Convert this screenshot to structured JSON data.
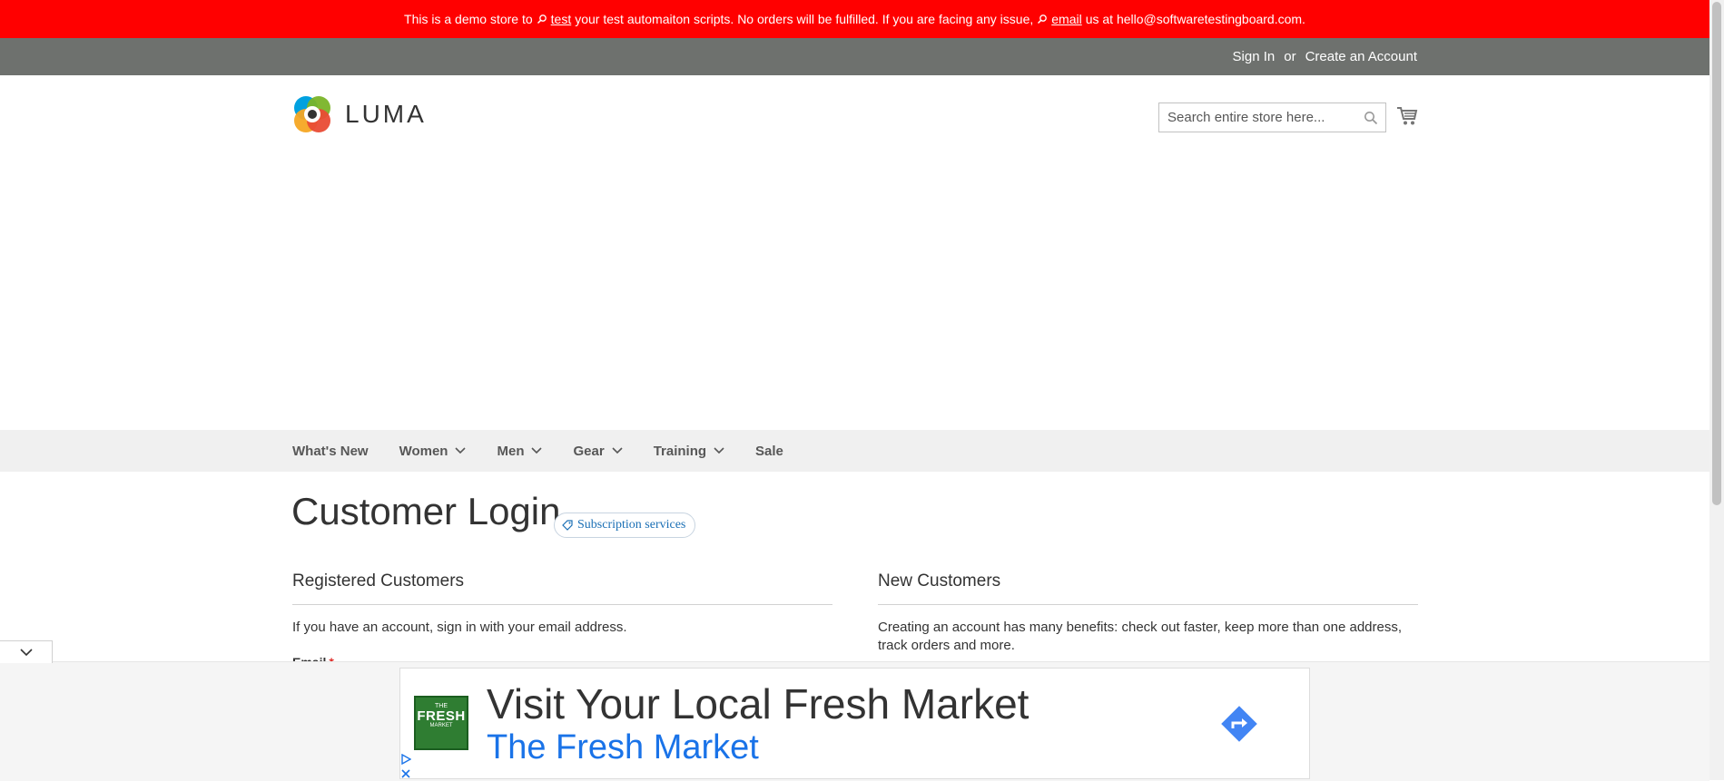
{
  "notice": {
    "part1": "This is a demo store to",
    "link1": "test",
    "part2": "your test automaiton scripts. No orders will be fulfilled. If you are facing any issue,",
    "link2": "email",
    "part3": "us at hello@softwaretestingboard.com."
  },
  "toplinks": {
    "sign_in": "Sign In",
    "or": "or",
    "create_account": "Create an Account"
  },
  "header": {
    "logo_text": "LUMA",
    "search_placeholder": "Search entire store here..."
  },
  "nav": {
    "items": [
      {
        "label": "What's New",
        "has_dropdown": false
      },
      {
        "label": "Women",
        "has_dropdown": true
      },
      {
        "label": "Men",
        "has_dropdown": true
      },
      {
        "label": "Gear",
        "has_dropdown": true
      },
      {
        "label": "Training",
        "has_dropdown": true
      },
      {
        "label": "Sale",
        "has_dropdown": false
      }
    ]
  },
  "main": {
    "title": "Customer Login",
    "subscription_badge": "Subscription services",
    "registered": {
      "title": "Registered Customers",
      "intro": "If you have an account, sign in with your email address.",
      "email_label": "Email",
      "required_mark": "*"
    },
    "new_customers": {
      "title": "New Customers",
      "intro": "Creating an account has many benefits: check out faster, keep more than one address, track orders and more."
    }
  },
  "ad": {
    "logo_line1": "THE",
    "logo_line2": "FRESH",
    "logo_line3": "MARKET",
    "headline": "Visit Your Local Fresh Market",
    "brand": "The Fresh Market"
  },
  "colors": {
    "notice_bg": "#ff0000",
    "topbar_bg": "#6e716e",
    "nav_bg": "#f0f0f0",
    "ad_brand": "#1a73e8",
    "ad_cta": "#4285f4"
  }
}
